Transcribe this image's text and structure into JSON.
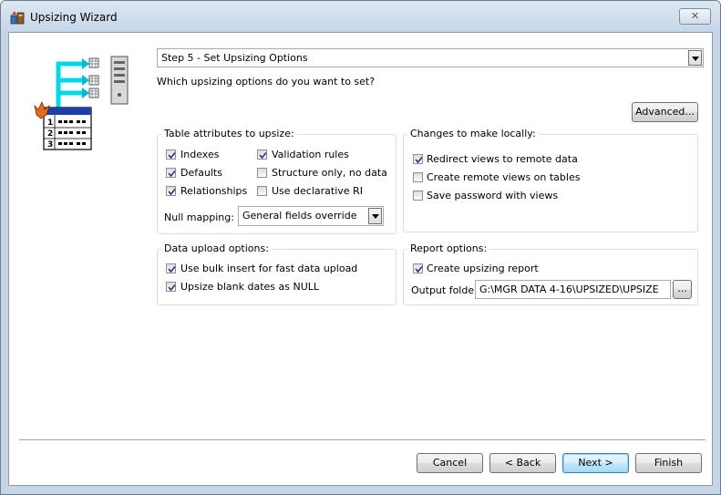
{
  "window": {
    "title": "Upsizing Wizard",
    "close_glyph": "✕"
  },
  "step_combo": {
    "value": "Step 5 - Set Upsizing Options"
  },
  "question": "Which upsizing options do you want to set?",
  "advanced_button": "Advanced...",
  "table_attributes": {
    "title": "Table attributes to upsize:",
    "options": [
      {
        "label": "Indexes",
        "checked": true
      },
      {
        "label": "Defaults",
        "checked": true
      },
      {
        "label": "Relationships",
        "checked": true
      },
      {
        "label": "Validation rules",
        "checked": true
      },
      {
        "label": "Structure only, no data",
        "checked": false
      },
      {
        "label": "Use declarative RI",
        "checked": false
      }
    ],
    "null_mapping_label": "Null mapping:",
    "null_mapping_value": "General fields override"
  },
  "local_changes": {
    "title": "Changes to make locally:",
    "options": [
      {
        "label": "Redirect views to remote data",
        "checked": true
      },
      {
        "label": "Create remote views on tables",
        "checked": false
      },
      {
        "label": "Save password with views",
        "checked": false
      }
    ]
  },
  "data_upload": {
    "title": "Data upload options:",
    "options": [
      {
        "label": "Use bulk insert for fast data upload",
        "checked": true
      },
      {
        "label": "Upsize blank dates as NULL",
        "checked": true
      }
    ]
  },
  "report": {
    "title": "Report options:",
    "create_report": {
      "label": "Create upsizing report",
      "checked": true
    },
    "output_folder_label": "Output folder",
    "output_folder_value": "G:\\MGR DATA 4-16\\UPSIZED\\UPSIZE",
    "browse_label": "..."
  },
  "footer": {
    "cancel": "Cancel",
    "back": "< Back",
    "next": "Next >",
    "finish": "Finish"
  },
  "illustration": {
    "row_numbers": [
      "1",
      "2",
      "3"
    ]
  }
}
